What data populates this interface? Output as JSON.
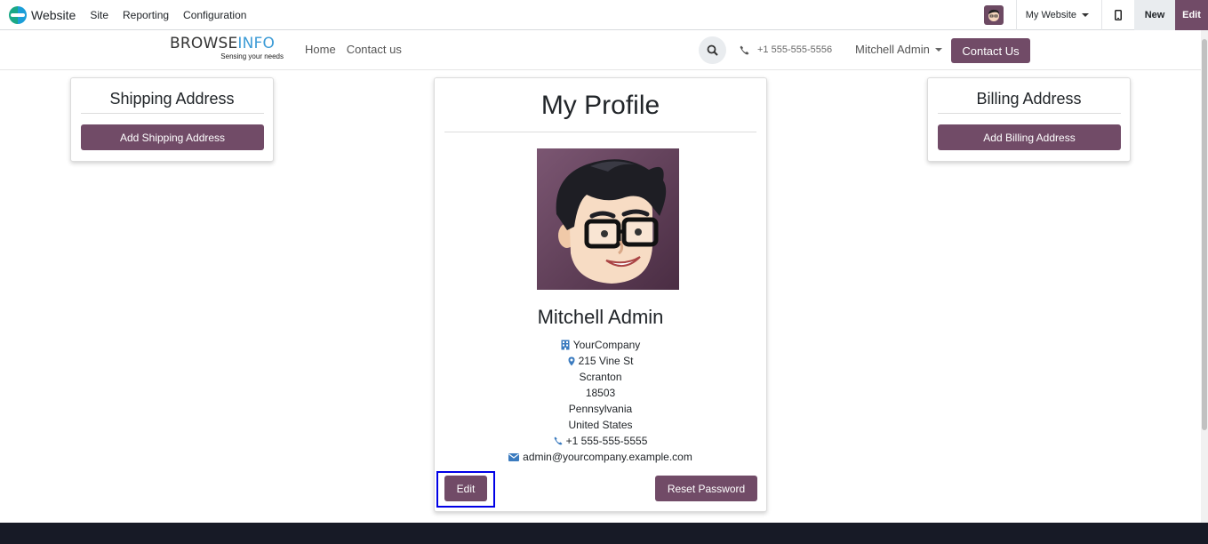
{
  "topbar": {
    "app_name": "Website",
    "menu": [
      "Site",
      "Reporting",
      "Configuration"
    ],
    "website_selector": "My Website",
    "new_label": "New",
    "edit_label": "Edit"
  },
  "header": {
    "brand_main": "BROWSE",
    "brand_accent": "INFO",
    "brand_tagline": "Sensing your needs",
    "nav": [
      "Home",
      "Contact us"
    ],
    "phone": "+1 555-555-5556",
    "user": "Mitchell Admin",
    "contact_button": "Contact Us"
  },
  "shipping": {
    "title": "Shipping Address",
    "button": "Add Shipping Address"
  },
  "billing": {
    "title": "Billing Address",
    "button": "Add Billing Address"
  },
  "profile": {
    "title": "My Profile",
    "name": "Mitchell Admin",
    "company": "YourCompany",
    "street": "215 Vine St",
    "city": "Scranton",
    "zip": "18503",
    "state": "Pennsylvania",
    "country": "United States",
    "phone": "+1 555-555-5555",
    "email": "admin@yourcompany.example.com",
    "edit_button": "Edit",
    "reset_button": "Reset Password"
  },
  "colors": {
    "brand": "#714b67",
    "icon_blue": "#3b7bbf",
    "highlight": "#0000e6",
    "footer": "#171a26"
  }
}
